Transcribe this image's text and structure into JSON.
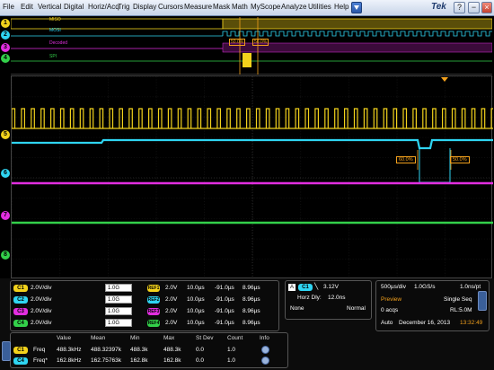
{
  "menu": {
    "items": [
      "File",
      "Edit",
      "Vertical",
      "Digital",
      "Horiz/Acq",
      "Trig",
      "Display",
      "Cursors",
      "Measure",
      "Mask",
      "Math",
      "MyScope",
      "Analyze",
      "Utilities",
      "Help"
    ],
    "brand": "Tek"
  },
  "overview": {
    "bus_labels": [
      "MISO",
      "MOSI",
      "Decoded",
      "SPI"
    ],
    "cursor_readouts": [
      "50.0%",
      "50.0%"
    ]
  },
  "graticule": {
    "cursor_readouts": [
      "60.0%",
      "50.0%"
    ]
  },
  "channels": [
    {
      "id": "C1",
      "scale": "2.0V/div",
      "bw": "1.0G",
      "ref": "2.0V",
      "t1": "10.0µs",
      "t2": "-91.0µs",
      "t3": "8.96µs",
      "color": "#f2d21c"
    },
    {
      "id": "C2",
      "scale": "2.0V/div",
      "bw": "1.0G",
      "ref": "2.0V",
      "t1": "10.0µs",
      "t2": "-91.0µs",
      "t3": "8.96µs",
      "color": "#2fd5f2"
    },
    {
      "id": "C3",
      "scale": "2.0V/div",
      "bw": "1.0G",
      "ref": "2.0V",
      "t1": "10.0µs",
      "t2": "-91.0µs",
      "t3": "8.96µs",
      "color": "#e22ee0"
    },
    {
      "id": "C4",
      "scale": "2.0V/div",
      "bw": "1.0G",
      "ref": "2.0V",
      "t1": "10.0µs",
      "t2": "-91.0µs",
      "t3": "8.96µs",
      "color": "#33d04a"
    }
  ],
  "channel_marker_labels": [
    "1",
    "2",
    "3",
    "4",
    "5",
    "6",
    "7",
    "8"
  ],
  "ref_badges": [
    "REF1",
    "REF2",
    "REF3",
    "REF4"
  ],
  "trigger": {
    "source": "C1",
    "level": "3.12V",
    "horz_dly_label": "Horz Dly:",
    "horz_dly": "12.0ns",
    "coupling": "None",
    "mode": "Normal"
  },
  "acquisition": {
    "timebase": "500µs/div",
    "sample_rate": "1.0GS/s",
    "resolution": "1.0ns/pt",
    "mode": "Preview",
    "seq": "Single Seq",
    "acqs": "0 acqs",
    "record_length": "RL:5.0M",
    "auto": "Auto",
    "date": "December 16, 2013",
    "time": "13:32:49"
  },
  "measurements": {
    "headers": [
      "Value",
      "Mean",
      "Min",
      "Max",
      "St Dev",
      "Count",
      "Info"
    ],
    "rows": [
      {
        "ch": "C1",
        "name": "Freq",
        "value": "488.3kHz",
        "mean": "488.32397k",
        "min": "488.3k",
        "max": "488.3k",
        "stdev": "0.0",
        "count": "1.0"
      },
      {
        "ch": "C4",
        "name": "Freq*",
        "value": "162.8kHz",
        "mean": "162.75763k",
        "min": "162.8k",
        "max": "162.8k",
        "stdev": "0.0",
        "count": "1.0"
      }
    ]
  }
}
